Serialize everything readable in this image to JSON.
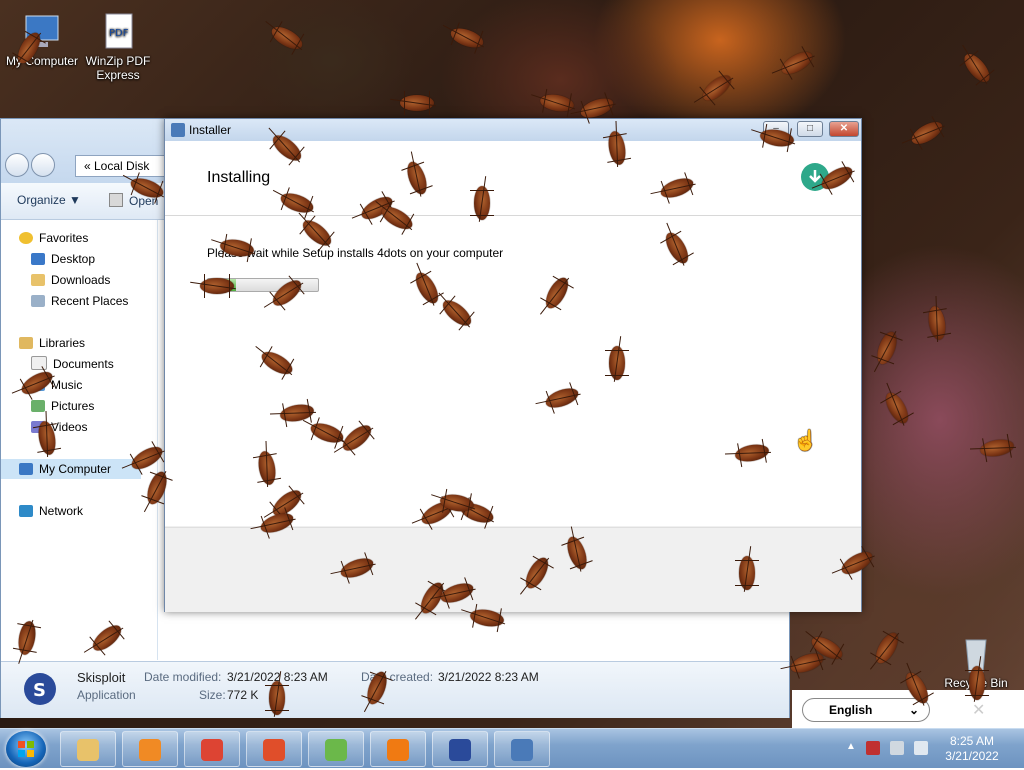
{
  "desktop": {
    "icons": [
      {
        "label": "My Computer"
      },
      {
        "label": "WinZip PDF Express"
      },
      {
        "label": "Recycle Bin"
      }
    ]
  },
  "explorer": {
    "address": "«  Local Disk",
    "toolbar": {
      "organize": "Organize ▼",
      "open": "Open"
    },
    "sidebar": {
      "favorites": "Favorites",
      "desktop": "Desktop",
      "downloads": "Downloads",
      "recent_places": "Recent Places",
      "libraries": "Libraries",
      "documents": "Documents",
      "music": "Music",
      "pictures": "Pictures",
      "videos": "Videos",
      "my_computer": "My Computer",
      "network": "Network"
    },
    "details": {
      "name": "Skisploit",
      "type": "Application",
      "date_modified_label": "Date modified:",
      "date_modified": "3/21/2022 8:23 AM",
      "size_label": "Size:",
      "size": "772 K",
      "date_created_label": "Date created:",
      "date_created": "3/21/2022 8:23 AM"
    }
  },
  "installer": {
    "title": "Installer",
    "heading": "Installing",
    "message": "Please wait while Setup installs 4dots on your computer",
    "progress": 0.25,
    "buttons": {
      "minimize": "–",
      "maximize": "□",
      "close": "✕"
    }
  },
  "language": {
    "selected": "English"
  },
  "taskbar": {
    "time": "8:25 AM",
    "date": "3/21/2022",
    "apps": [
      {
        "name": "file-explorer",
        "color": "#e8c26a"
      },
      {
        "name": "media-player",
        "color": "#f08a24"
      },
      {
        "name": "chrome",
        "color": "#dd4433"
      },
      {
        "name": "office",
        "color": "#e04e2a"
      },
      {
        "name": "winzip",
        "color": "#6bb84a"
      },
      {
        "name": "avast",
        "color": "#f07a12"
      },
      {
        "name": "skisploit",
        "color": "#2a4a9a"
      },
      {
        "name": "installer",
        "color": "#4a7ab8"
      }
    ]
  },
  "colors": {
    "accent": "#1e395b",
    "progress": "#4caf3c",
    "close": "#c2462e"
  }
}
